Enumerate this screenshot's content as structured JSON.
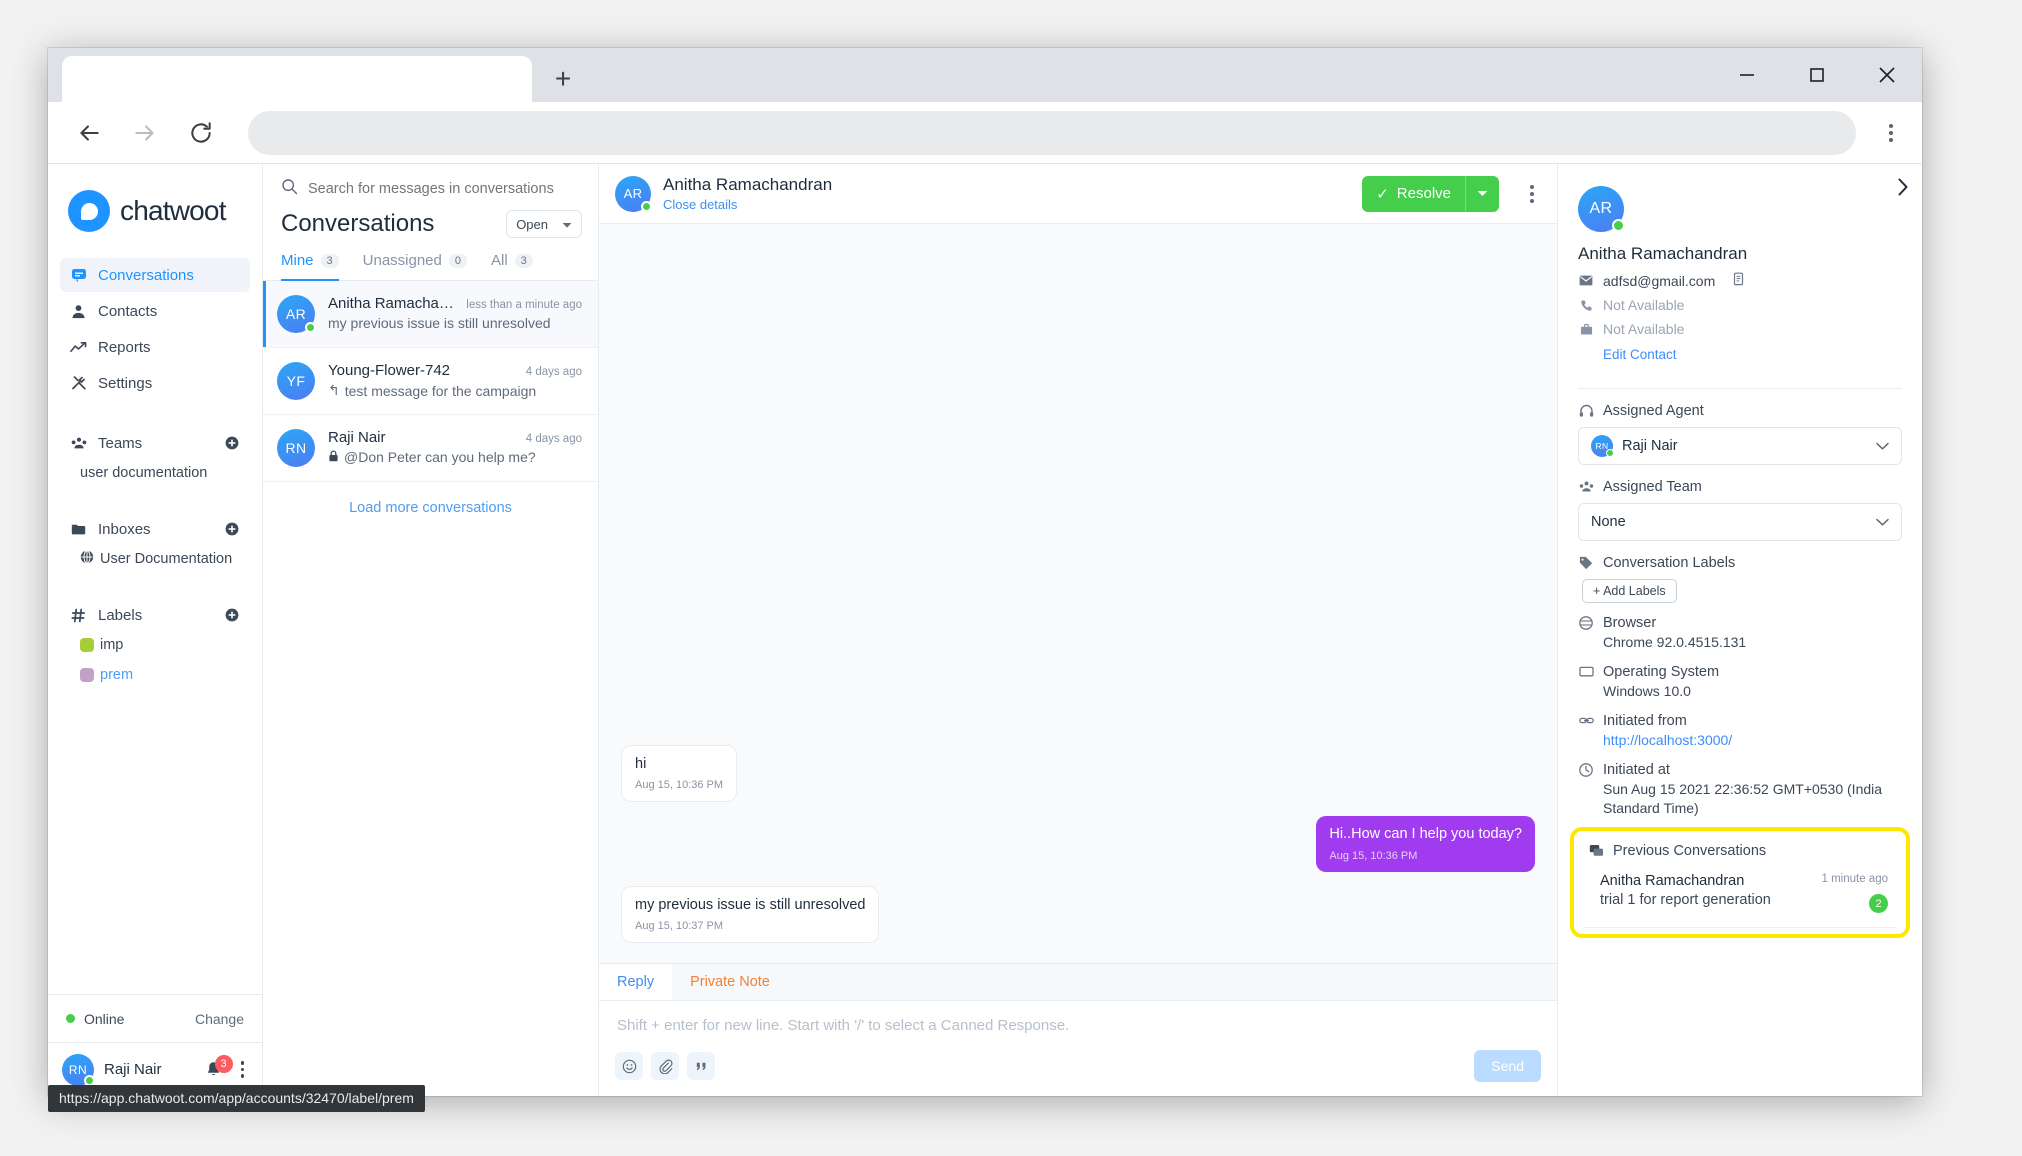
{
  "browser": {
    "tab_title": "",
    "new_tab_label": "+",
    "omnibox_value": "",
    "omnibox_placeholder": "",
    "minimize_label": "—",
    "maximize_label": "□",
    "close_label": "✕",
    "status_link": "https://app.chatwoot.com/app/accounts/32470/label/prem"
  },
  "sidebar": {
    "brand": "chatwoot",
    "nav": [
      {
        "label": "Conversations",
        "icon": "chat-icon",
        "active": true
      },
      {
        "label": "Contacts",
        "icon": "person-icon",
        "active": false
      },
      {
        "label": "Reports",
        "icon": "trend-icon",
        "active": false
      },
      {
        "label": "Settings",
        "icon": "tools-icon",
        "active": false
      }
    ],
    "teams": {
      "title": "Teams",
      "add": "+",
      "items": [
        "user documentation"
      ]
    },
    "inboxes": {
      "title": "Inboxes",
      "add": "+",
      "items": [
        "User Documentation"
      ]
    },
    "labels": {
      "title": "Labels",
      "add": "+",
      "items": [
        {
          "name": "imp",
          "color": "#a6ce39",
          "active": false
        },
        {
          "name": "prem",
          "color": "#c0a2c7",
          "active": true
        }
      ]
    },
    "availability": {
      "status": "Online",
      "change_label": "Change"
    },
    "agent": {
      "initials": "RN",
      "name": "Raji Nair",
      "notification_count": "3"
    }
  },
  "conversation_list": {
    "search_placeholder": "Search for messages in conversations",
    "title": "Conversations",
    "filter_value": "Open",
    "tabs": [
      {
        "label": "Mine",
        "count": "3",
        "active": true
      },
      {
        "label": "Unassigned",
        "count": "0",
        "active": false
      },
      {
        "label": "All",
        "count": "3",
        "active": false
      }
    ],
    "items": [
      {
        "initials": "AR",
        "name": "Anitha Ramachandran",
        "preview": "my previous issue is still unresolved",
        "prefix": "",
        "time": "less than a minute ago",
        "online": true,
        "selected": true
      },
      {
        "initials": "YF",
        "name": "Young-Flower-742",
        "preview": "test message for the campaign",
        "prefix": "↰",
        "time": "4 days ago",
        "online": false,
        "selected": false
      },
      {
        "initials": "RN",
        "name": "Raji Nair",
        "preview": "@Don Peter can you help me?",
        "prefix": "🔒",
        "time": "4 days ago",
        "online": false,
        "selected": false
      }
    ],
    "load_more": "Load more conversations"
  },
  "chat": {
    "header": {
      "initials": "AR",
      "name": "Anitha Ramachandran",
      "subtitle": "Close details",
      "resolve_label": "Resolve",
      "resolve_check": "✓"
    },
    "messages": [
      {
        "direction": "in",
        "text": "hi",
        "time": "Aug 15, 10:36 PM"
      },
      {
        "direction": "out",
        "text": "Hi..How can I help you today?",
        "time": "Aug 15, 10:36 PM"
      },
      {
        "direction": "in",
        "text": "my previous issue is still unresolved",
        "time": "Aug 15, 10:37 PM"
      }
    ],
    "reply": {
      "tabs": [
        {
          "label": "Reply",
          "active": true
        },
        {
          "label": "Private Note",
          "active": false
        }
      ],
      "placeholder": "Shift + enter for new line. Start with '/' to select a Canned Response.",
      "value": "",
      "send_label": "Send",
      "tools": [
        {
          "name": "emoji-icon",
          "glyph": "☺"
        },
        {
          "name": "attachment-icon",
          "glyph": "📎"
        },
        {
          "name": "canned-response-icon",
          "glyph": "“"
        }
      ]
    }
  },
  "contact_panel": {
    "initials": "AR",
    "name": "Anitha Ramachandran",
    "email": "adfsd@gmail.com",
    "phone": "Not Available",
    "company": "Not Available",
    "edit_label": "Edit Contact",
    "assigned_agent": {
      "title": "Assigned Agent",
      "initials": "RN",
      "value": "Raji Nair"
    },
    "assigned_team": {
      "title": "Assigned Team",
      "value": "None"
    },
    "conversation_labels": {
      "title": "Conversation Labels",
      "add_label": "+ Add Labels"
    },
    "attributes": [
      {
        "title": "Browser",
        "value": "Chrome 92.0.4515.131",
        "icon": "browser-icon",
        "link": false
      },
      {
        "title": "Operating System",
        "value": "Windows 10.0",
        "icon": "monitor-icon",
        "link": false
      },
      {
        "title": "Initiated from",
        "value": "http://localhost:3000/",
        "icon": "link-icon",
        "link": true
      },
      {
        "title": "Initiated at",
        "value": "Sun Aug 15 2021 22:36:52 GMT+0530 (India Standard Time)",
        "icon": "clock-icon",
        "link": false
      }
    ],
    "previous_conversations": {
      "title": "Previous Conversations",
      "highlight_color": "#ffe600",
      "items": [
        {
          "name": "Anitha Ramachandran",
          "preview": "trial 1 for report generation",
          "time": "1 minute ago",
          "unread": "2"
        }
      ]
    }
  }
}
